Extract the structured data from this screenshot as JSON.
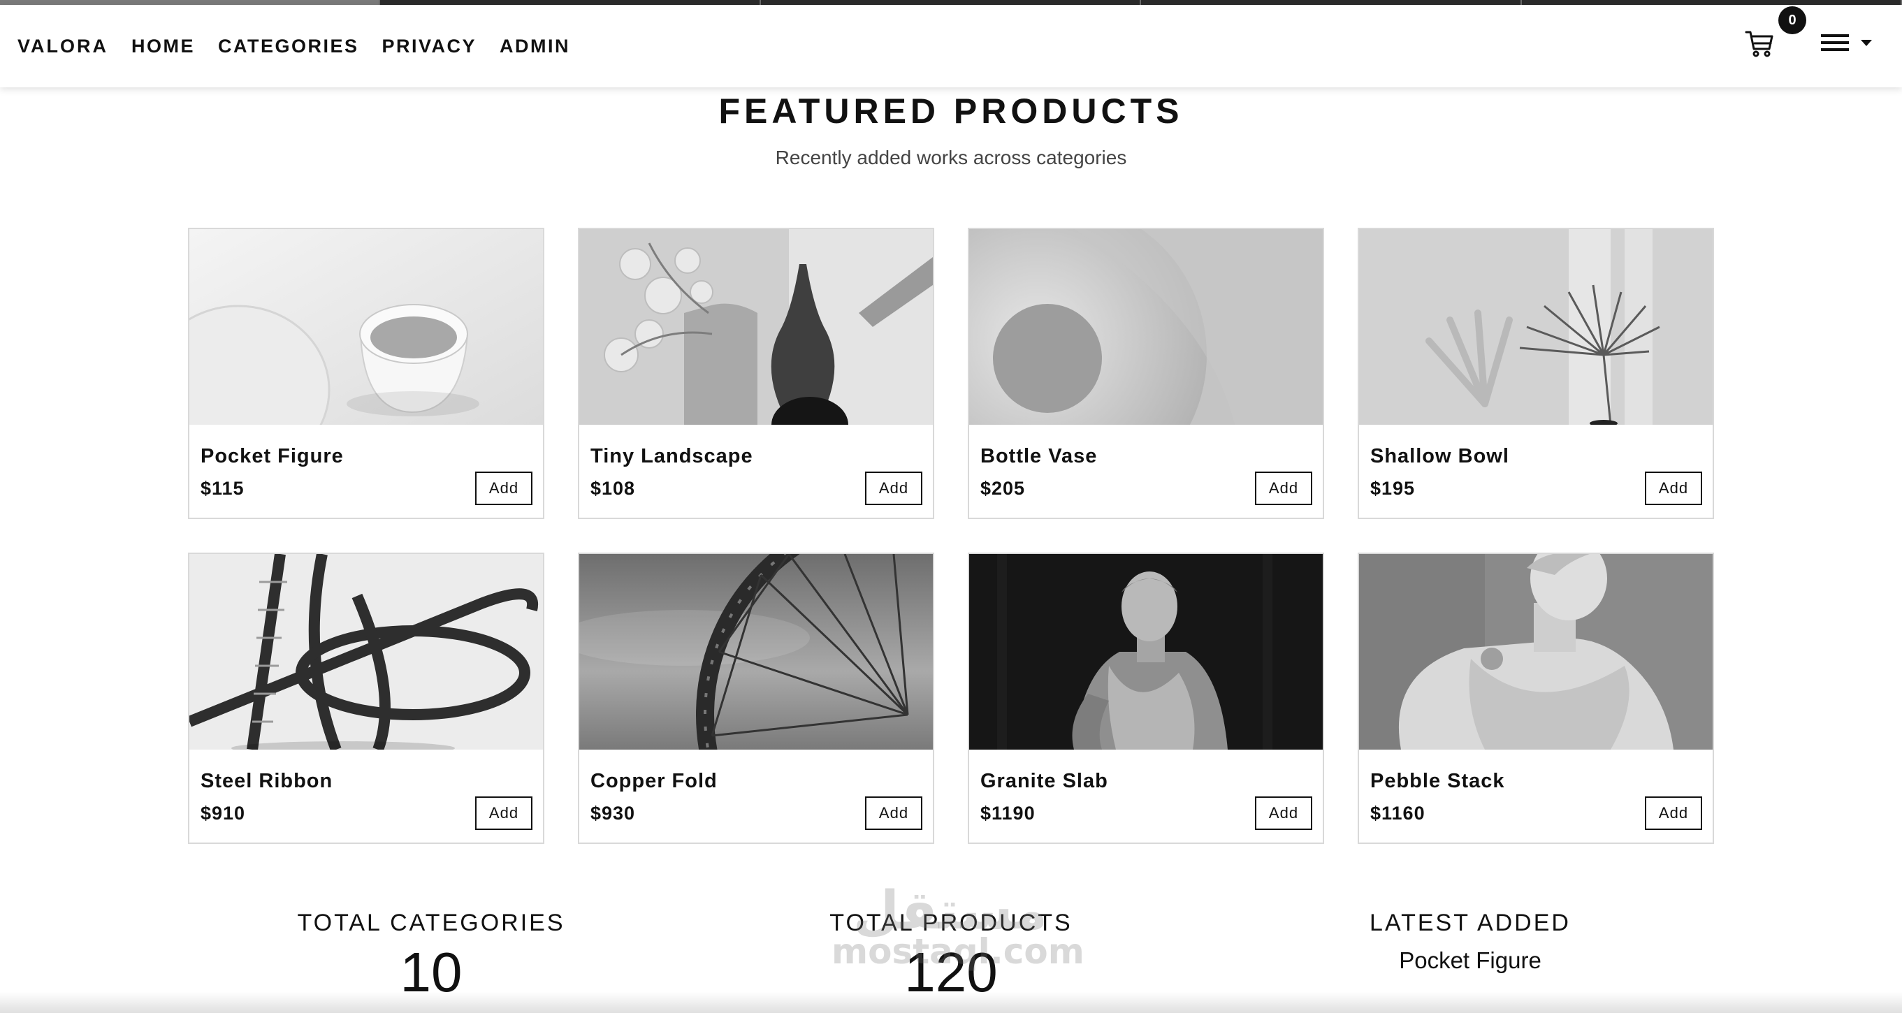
{
  "app": {
    "brand": "VALORA"
  },
  "nav": {
    "links": [
      "HOME",
      "CATEGORIES",
      "PRIVACY",
      "ADMIN"
    ],
    "cart_count": "0"
  },
  "section": {
    "title": "FEATURED PRODUCTS",
    "subtitle": "Recently added works across categories"
  },
  "products": [
    {
      "name": "Pocket Figure",
      "price": "$115",
      "button": "Add",
      "image": "cup-and-plate-photo"
    },
    {
      "name": "Tiny Landscape",
      "price": "$108",
      "button": "Add",
      "image": "vases-with-flowers-photo"
    },
    {
      "name": "Bottle Vase",
      "price": "$205",
      "button": "Add",
      "image": "ring-sculpture-photo"
    },
    {
      "name": "Shallow Bowl",
      "price": "$195",
      "button": "Add",
      "image": "palm-leaf-photo"
    },
    {
      "name": "Steel Ribbon",
      "price": "$910",
      "button": "Add",
      "image": "twisted-lattice-photo"
    },
    {
      "name": "Copper Fold",
      "price": "$930",
      "button": "Add",
      "image": "ferris-wheel-photo"
    },
    {
      "name": "Granite Slab",
      "price": "$1190",
      "button": "Add",
      "image": "roman-statue-photo"
    },
    {
      "name": "Pebble Stack",
      "price": "$1160",
      "button": "Add",
      "image": "marble-bust-photo"
    }
  ],
  "stats": {
    "total_categories_label": "TOTAL CATEGORIES",
    "total_categories_value": "10",
    "total_products_label": "TOTAL PRODUCTS",
    "total_products_value": "120",
    "latest_added_label": "LATEST ADDED",
    "latest_added_value": "Pocket Figure"
  },
  "watermark": {
    "arabic": "مستقل",
    "latin": "mostaql.com"
  },
  "icons": {
    "cart": "cart-icon",
    "menu": "hamburger-icon",
    "dropdown": "caret-down-icon"
  }
}
